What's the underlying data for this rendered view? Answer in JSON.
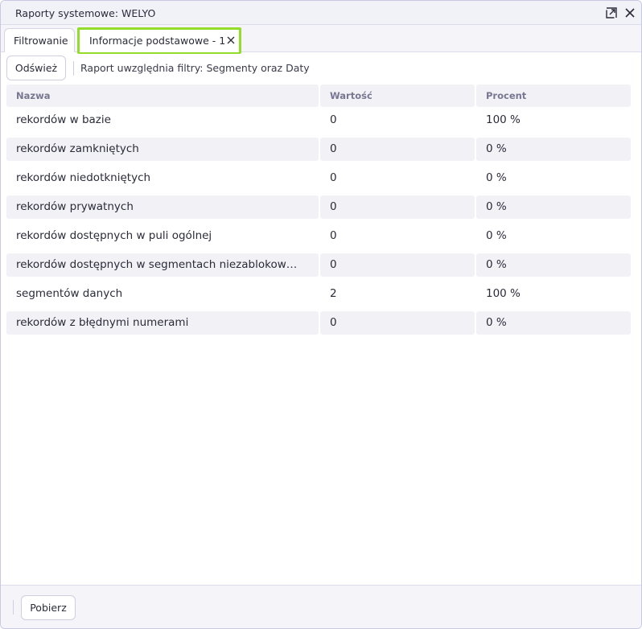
{
  "window": {
    "title": "Raporty systemowe: WELYO"
  },
  "tabs": [
    {
      "label": "Filtrowanie"
    },
    {
      "label": "Informacje podstawowe - 1"
    }
  ],
  "colors": {
    "active_tab_highlight": "#93dc2a",
    "row_alt_bg": "#f1f1f6"
  },
  "icons": {
    "popout": "popout-icon",
    "close_window": "close-icon",
    "close_tab": "close-tab-icon"
  },
  "toolbar": {
    "refresh_label": "Odśwież",
    "filter_info": "Raport uwzględnia filtry: Segmenty oraz Daty"
  },
  "table": {
    "columns": [
      "Nazwa",
      "Wartość",
      "Procent"
    ],
    "rows": [
      {
        "name": "rekordów w bazie",
        "value": "0",
        "percent": "100 %"
      },
      {
        "name": "rekordów zamkniętych",
        "value": "0",
        "percent": "0 %"
      },
      {
        "name": "rekordów niedotkniętych",
        "value": "0",
        "percent": "0 %"
      },
      {
        "name": "rekordów prywatnych",
        "value": "0",
        "percent": "0 %"
      },
      {
        "name": "rekordów dostępnych w puli ogólnej",
        "value": "0",
        "percent": "0 %"
      },
      {
        "name": "rekordów dostępnych w segmentach niezablokow…",
        "value": "0",
        "percent": "0 %"
      },
      {
        "name": "segmentów danych",
        "value": "2",
        "percent": "100 %"
      },
      {
        "name": "rekordów z błędnymi numerami",
        "value": "0",
        "percent": "0 %"
      }
    ]
  },
  "footer": {
    "download_label": "Pobierz"
  }
}
